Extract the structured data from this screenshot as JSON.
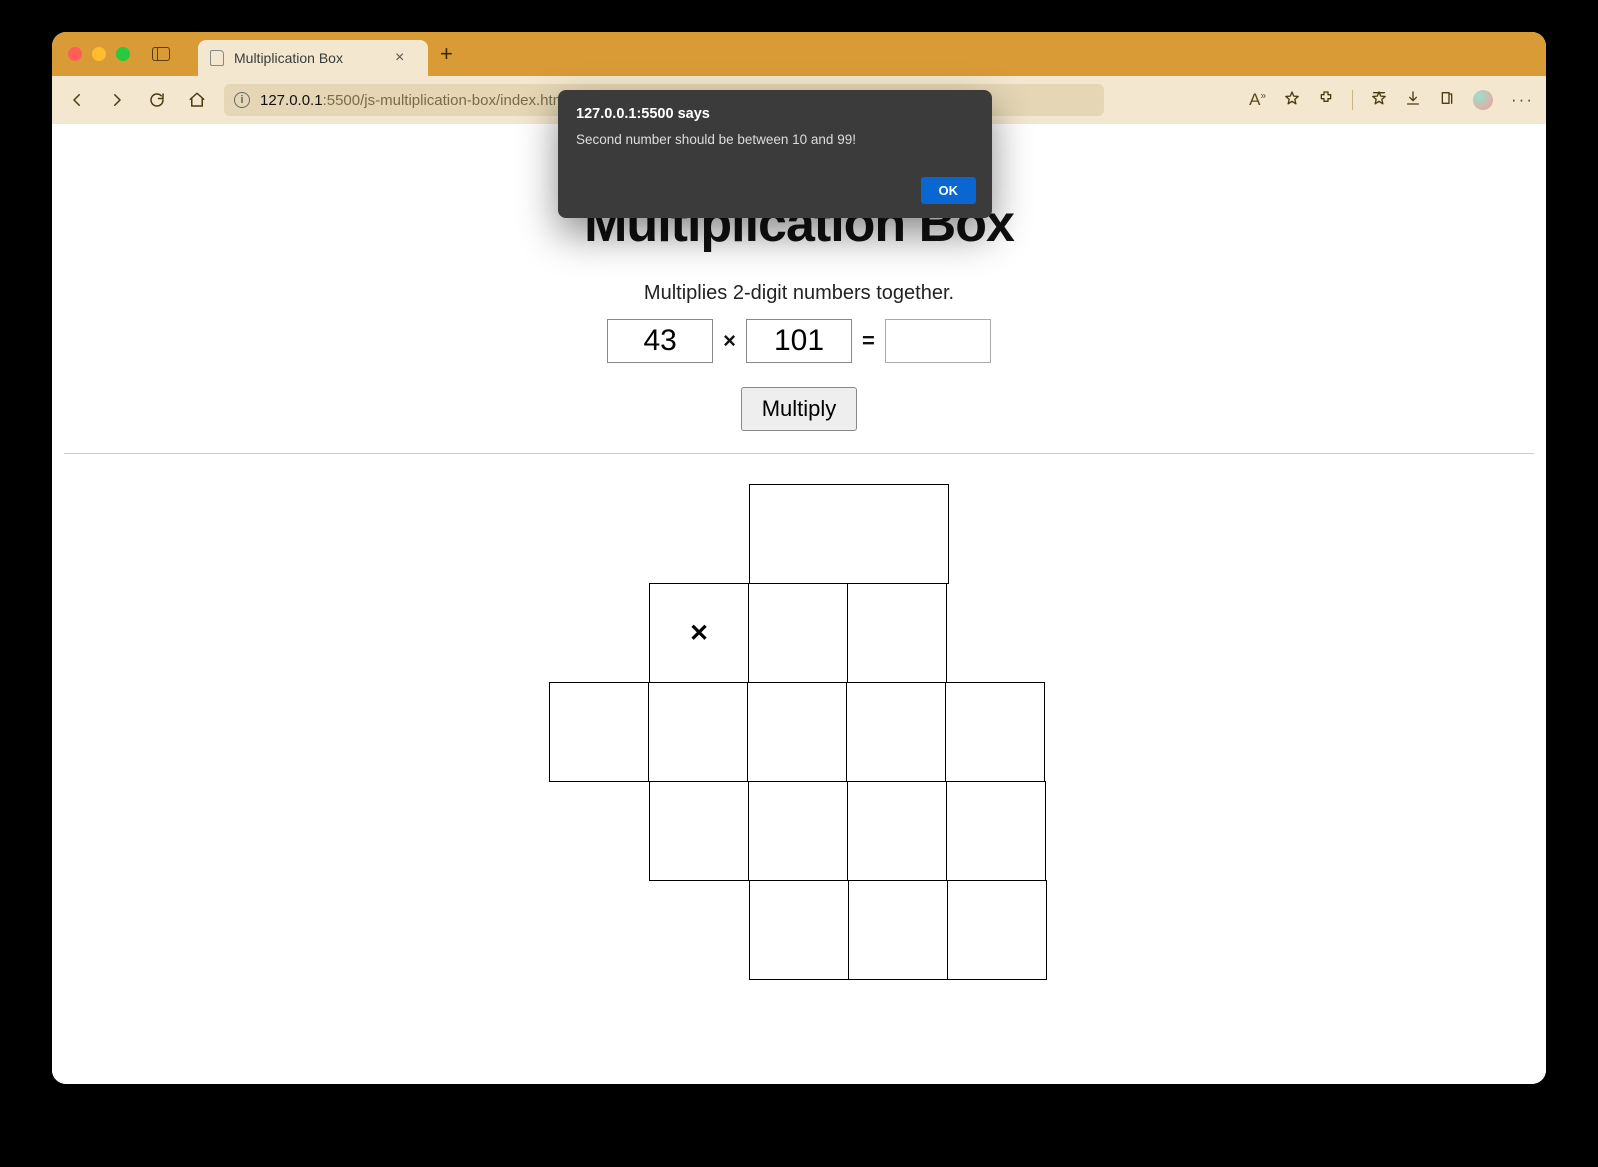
{
  "browser": {
    "tab_title": "Multiplication Box",
    "url_host": "127.0.0.1",
    "url_port": ":5500",
    "url_path": "/js-multiplication-box/index.html"
  },
  "alert": {
    "header": "127.0.0.1:5500 says",
    "message": "Second number should be between 10 and 99!",
    "ok_label": "OK"
  },
  "page": {
    "title": "Multiplication Box",
    "subtitle": "Multiplies 2-digit numbers together.",
    "input_a": "43",
    "input_b": "101",
    "result": "",
    "times_symbol": "×",
    "equals_symbol": "=",
    "multiply_button": "Multiply",
    "grid_x_symbol": "✕"
  }
}
